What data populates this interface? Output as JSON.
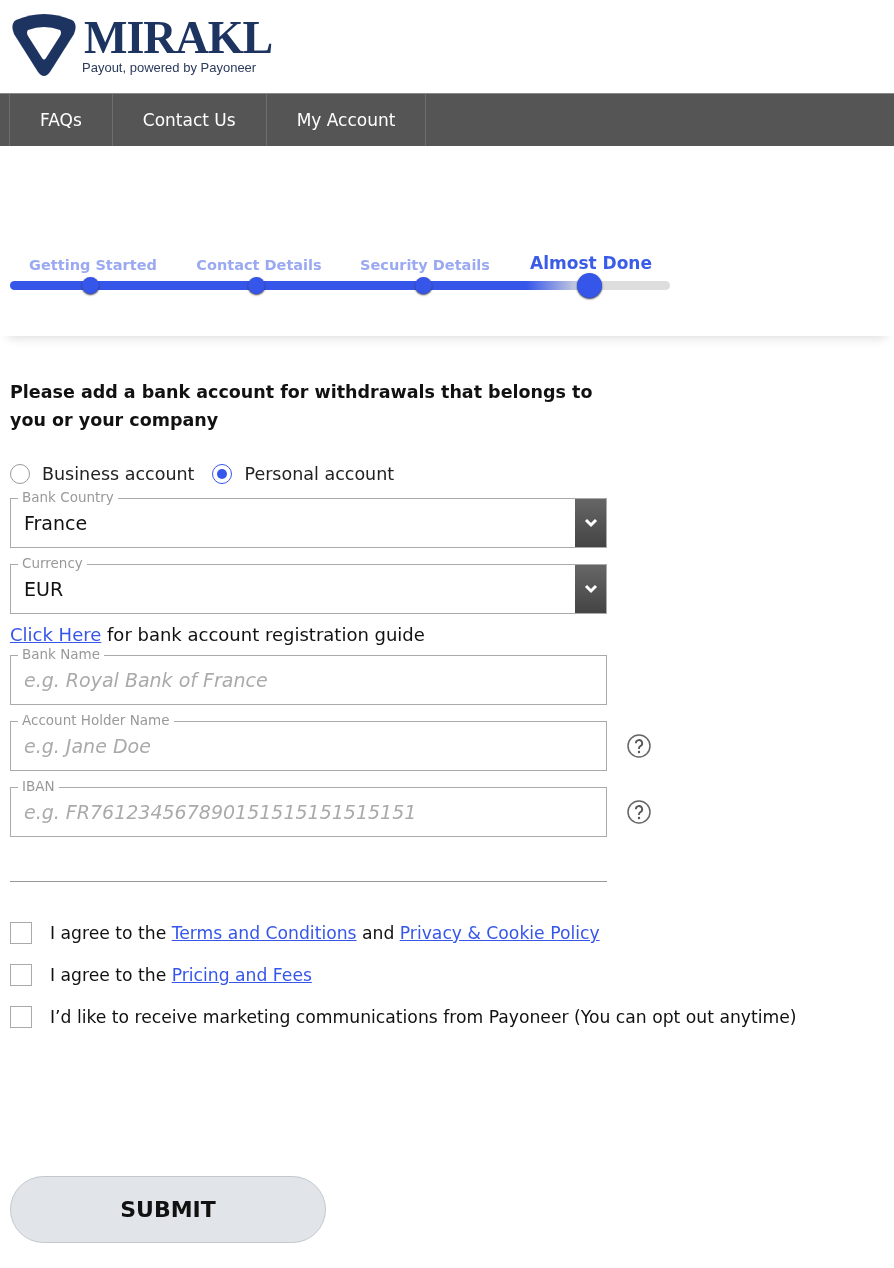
{
  "logo": {
    "name": "MIRAKL",
    "tagline": "Payout, powered by Payoneer"
  },
  "nav": [
    {
      "label": "FAQs"
    },
    {
      "label": "Contact Us"
    },
    {
      "label": "My Account"
    }
  ],
  "steps": {
    "items": [
      {
        "label": "Getting Started",
        "selected": false
      },
      {
        "label": "Contact Details",
        "selected": false
      },
      {
        "label": "Security Details",
        "selected": false
      },
      {
        "label": "Almost Done",
        "selected": true
      }
    ],
    "level": 0.87
  },
  "heading": "Please add a bank account for withdrawals that belongs to you or your company",
  "account_type": [
    {
      "label": "Business account",
      "selected": false
    },
    {
      "label": "Personal account",
      "selected": true
    }
  ],
  "fields": [
    {
      "kind": "select",
      "label": "Bank Country",
      "value": "France"
    },
    {
      "kind": "select",
      "label": "Currency",
      "value": "EUR"
    },
    {
      "kind": "note",
      "parts": [
        {
          "kind": "link",
          "text": "Click Here"
        },
        {
          "kind": "text",
          "text": " for bank account registration guide"
        }
      ]
    },
    {
      "kind": "text",
      "label": "Bank Name",
      "placeholder": "e.g. Royal Bank of France"
    },
    {
      "kind": "text",
      "label": "Account Holder Name",
      "placeholder": "e.g. Jane Doe",
      "help": true
    },
    {
      "kind": "text",
      "label": "IBAN",
      "placeholder": "e.g. FR761234567890151515151515151",
      "help": true
    }
  ],
  "agreements": [
    {
      "checked": false,
      "parts": [
        {
          "kind": "text",
          "text": "I agree to the "
        },
        {
          "kind": "link",
          "text": "Terms and Conditions"
        },
        {
          "kind": "text",
          "text": " and "
        },
        {
          "kind": "link",
          "text": "Privacy & Cookie Policy"
        }
      ]
    },
    {
      "checked": false,
      "parts": [
        {
          "kind": "text",
          "text": "I agree to the "
        },
        {
          "kind": "link",
          "text": "Pricing and Fees"
        }
      ]
    },
    {
      "checked": false,
      "parts": [
        {
          "kind": "text",
          "text": "I’d like to receive marketing communications from Payoneer (You can opt out anytime)"
        }
      ]
    }
  ],
  "submit": "SUBMIT"
}
